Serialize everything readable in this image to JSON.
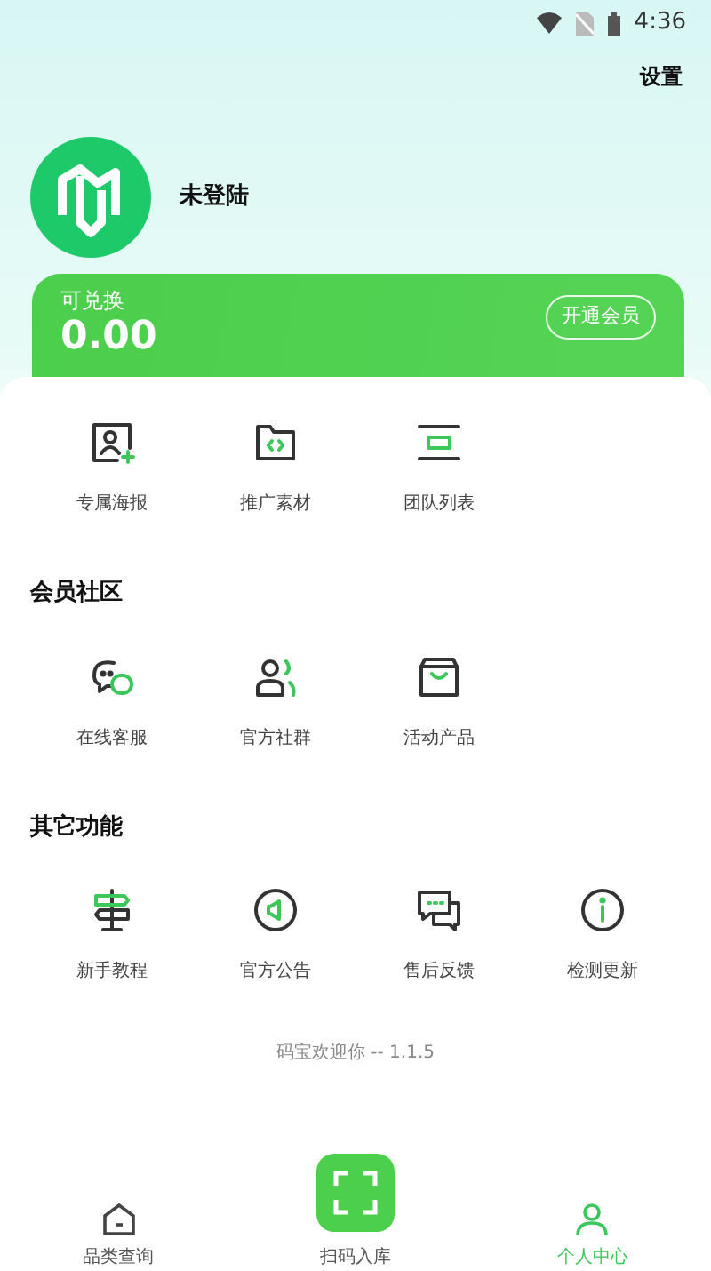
{
  "status_bar": {
    "time": "4:36"
  },
  "header": {
    "settings": "设置"
  },
  "profile": {
    "name": "未登陆"
  },
  "balance": {
    "label": "可兑换",
    "value": "0.00",
    "button": "开通会员"
  },
  "sections": [
    {
      "items": [
        {
          "label": "专属海报"
        },
        {
          "label": "推广素材"
        },
        {
          "label": "团队列表"
        }
      ]
    },
    {
      "title": "会员社区",
      "items": [
        {
          "label": "在线客服"
        },
        {
          "label": "官方社群"
        },
        {
          "label": "活动产品"
        }
      ]
    },
    {
      "title": "其它功能",
      "items": [
        {
          "label": "新手教程"
        },
        {
          "label": "官方公告"
        },
        {
          "label": "售后反馈"
        },
        {
          "label": "检测更新"
        }
      ]
    }
  ],
  "footer": "码宝欢迎你 -- 1.1.5",
  "bottom_nav": [
    {
      "label": "品类查询",
      "kind": "tab",
      "selected": false
    },
    {
      "label": "扫码入库",
      "kind": "raised",
      "selected": false
    },
    {
      "label": "个人中心",
      "kind": "tab",
      "selected": true
    }
  ]
}
